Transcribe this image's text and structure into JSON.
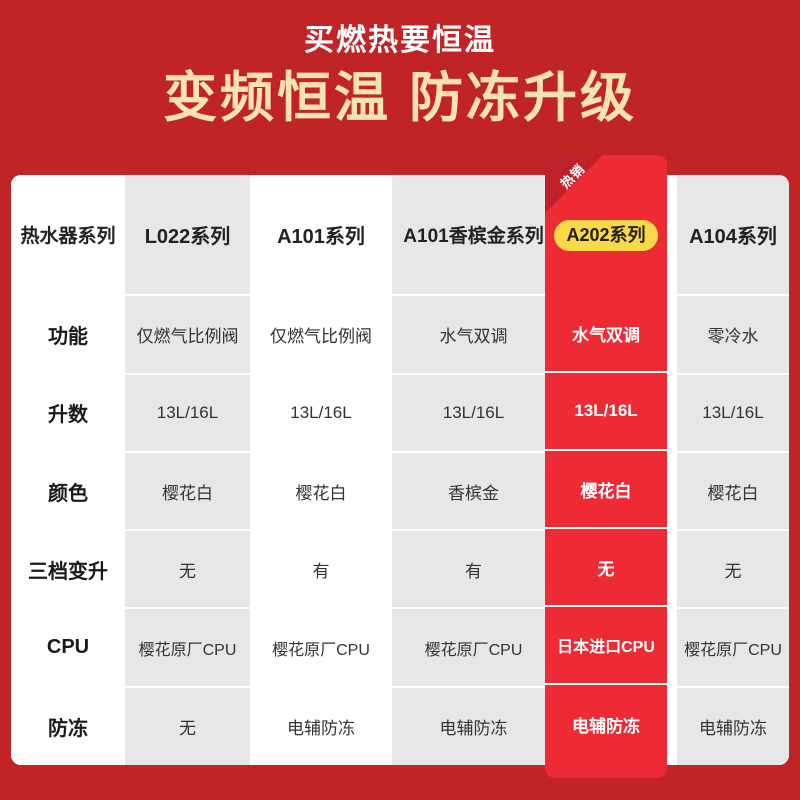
{
  "theme": {
    "background_red": "#C12424",
    "highlight_red": "#EE2B35",
    "ribbon_red": "#C0202A",
    "badge_yellow": "#F9D949",
    "headline_cream": "#F7E2B2",
    "cell_gray": "#E6E7E9",
    "cell_white": "#FFFFFF"
  },
  "header": {
    "subtitle": "买燃热要恒温",
    "title": "变频恒温 防冻升级"
  },
  "table": {
    "columns": [
      {
        "label": "热水器系列",
        "style": "white",
        "highlight": false
      },
      {
        "label": "L022系列",
        "style": "gray",
        "highlight": false
      },
      {
        "label": "A101系列",
        "style": "white",
        "highlight": false
      },
      {
        "label": "A101香槟金系列",
        "style": "gray",
        "highlight": false
      },
      {
        "label": "A202系列",
        "style": "highlight",
        "highlight": true
      },
      {
        "label": "A104系列",
        "style": "gray",
        "highlight": false
      }
    ],
    "highlight_badge": {
      "label": "A202系列",
      "ribbon": "热销"
    },
    "rows": [
      {
        "label": "功能",
        "cells": [
          "仅燃气比例阀",
          "仅燃气比例阀",
          "水气双调",
          "水气双调",
          "零冷水"
        ]
      },
      {
        "label": "升数",
        "cells": [
          "13L/16L",
          "13L/16L",
          "13L/16L",
          "13L/16L",
          "13L/16L"
        ]
      },
      {
        "label": "颜色",
        "cells": [
          "樱花白",
          "樱花白",
          "香槟金",
          "樱花白",
          "樱花白"
        ]
      },
      {
        "label": "三档变升",
        "cells": [
          "无",
          "有",
          "有",
          "无",
          "无"
        ]
      },
      {
        "label": "CPU",
        "cells": [
          "樱花原厂CPU",
          "樱花原厂CPU",
          "樱花原厂CPU",
          "日本进口CPU",
          "樱花原厂CPU"
        ]
      },
      {
        "label": "防冻",
        "cells": [
          "无",
          "电辅防冻",
          "电辅防冻",
          "电辅防冻",
          "电辅防冻"
        ]
      }
    ]
  }
}
